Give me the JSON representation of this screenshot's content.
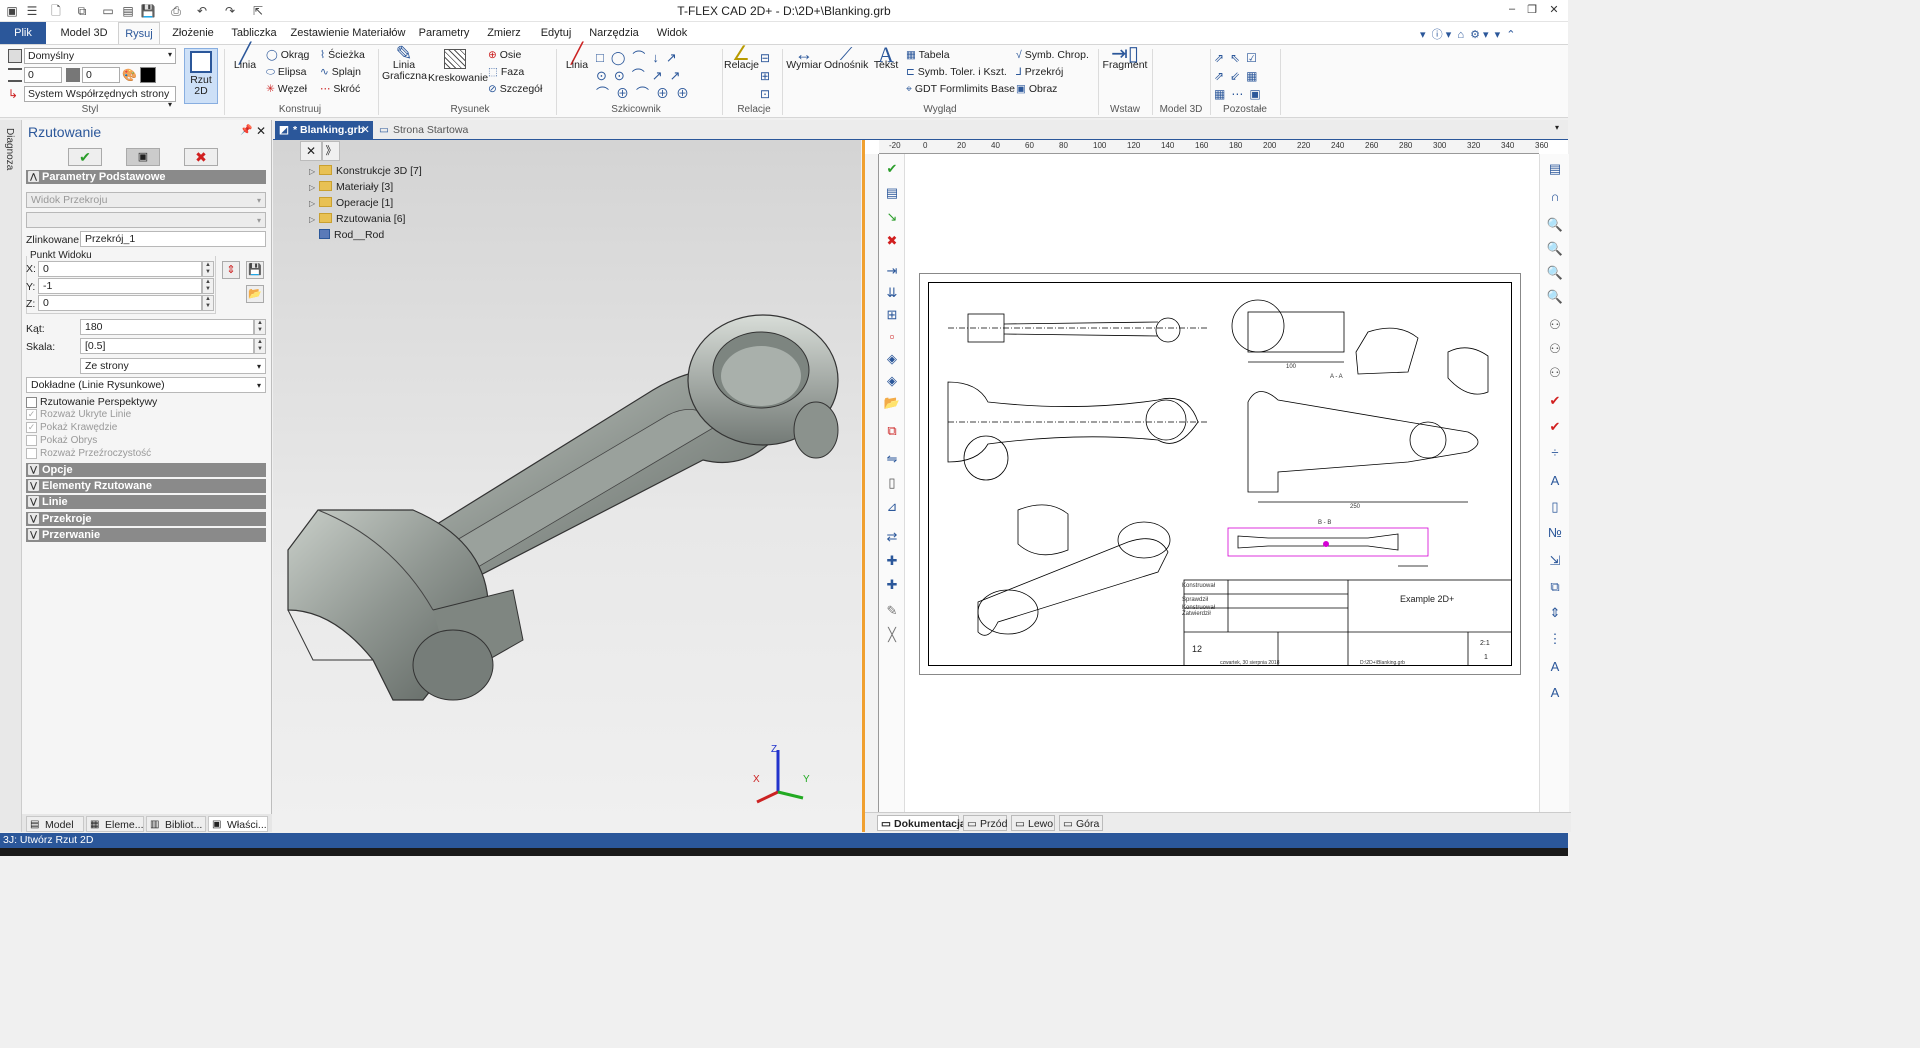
{
  "window": {
    "title": "T-FLEX CAD 2D+ - D:\\2D+\\Blanking.grb",
    "controls": [
      "–",
      "❐",
      "✕"
    ]
  },
  "menu_tabs": [
    {
      "label": "Plik"
    },
    {
      "label": "Model 3D"
    },
    {
      "label": "Rysuj"
    },
    {
      "label": "Złożenie"
    },
    {
      "label": "Tabliczka"
    },
    {
      "label": "Zestawienie Materiałów"
    },
    {
      "label": "Parametry"
    },
    {
      "label": "Zmierz"
    },
    {
      "label": "Edytuj"
    },
    {
      "label": "Narzędzia"
    },
    {
      "label": "Widok"
    }
  ],
  "ribbon": {
    "styl": {
      "style_value": "Domyślny",
      "num1": "0",
      "num2": "0",
      "coord_system": "System Współrzędnych strony",
      "rzut2d_label": "Rzut\n2D",
      "group_label": "Styl"
    },
    "konstruuj": {
      "linia": "Linia",
      "okrag": "Okrąg",
      "elipsa": "Elipsa",
      "wezel": "Węzeł",
      "sciezka": "Ścieżka",
      "splajn": "Splajn",
      "skroc": "Skróć",
      "group_label": "Konstruuj"
    },
    "rysunek": {
      "linia_graficzna": "Linia\nGraficzna",
      "kreskowanie": "Kreskowanie",
      "osie": "Osie",
      "faza": "Faza",
      "szczegol": "Szczegół",
      "group_label": "Rysunek"
    },
    "szkicownik": {
      "linia": "Linia",
      "group_label": "Szkicownik"
    },
    "relacje": {
      "relacje": "Relacje",
      "group_label": "Relacje"
    },
    "wyglad": {
      "wymiar": "Wymiar",
      "odnosnik": "Odnośnik",
      "tekst": "Tekst",
      "tabela": "Tabela",
      "symb_toler": "Symb. Toler. i Kszt.",
      "gdt": "GDT Formlimits Base",
      "symb_chrop": "Symb. Chrop.",
      "przekroj": "Przekrój",
      "obraz": "Obraz",
      "group_label": "Wygląd"
    },
    "wstaw": {
      "fragment": "Fragment",
      "group_label": "Wstaw"
    },
    "model3d": {
      "group_label": "Model 3D"
    },
    "pozostale": {
      "group_label": "Pozostałe"
    }
  },
  "left_strip": {
    "label": "Diagnoza"
  },
  "panel": {
    "title": "Rzutowanie",
    "sections": {
      "podstawowe": "Parametry Podstawowe",
      "opcje": "Opcje",
      "elementy": "Elementy Rzutowane",
      "linie": "Linie",
      "przekroje": "Przekroje",
      "przerwanie": "Przerwanie"
    },
    "widok_przekroju": "Widok Przekroju",
    "zlinkowane_label": "Zlinkowane:",
    "zlinkowane_value": "Przekrój_1",
    "punkt_widoku": "Punkt Widoku",
    "x_label": "X:",
    "x_value": "0",
    "y_label": "Y:",
    "y_value": "-1",
    "z_label": "Z:",
    "z_value": "0",
    "kat_label": "Kąt:",
    "kat_value": "180",
    "skala_label": "Skala:",
    "skala_value": "[0.5]",
    "ze_strony": "Ze strony",
    "dokladne": "Dokładne (Linie Rysunkowe)",
    "checks": [
      {
        "label": "Rzutowanie Perspektywy",
        "checked": false,
        "enabled": true
      },
      {
        "label": "Rozważ Ukryte Linie",
        "checked": true,
        "enabled": false
      },
      {
        "label": "Pokaż Krawędzie",
        "checked": true,
        "enabled": false
      },
      {
        "label": "Pokaż Obrys",
        "checked": false,
        "enabled": false
      },
      {
        "label": "Rozważ Przeźroczystość",
        "checked": false,
        "enabled": false
      }
    ],
    "bottom_tabs": [
      "Model ...",
      "Eleme...",
      "Bibliot...",
      "Właści..."
    ]
  },
  "doc_tabs": [
    {
      "label": "* Blanking.grb",
      "active": true
    },
    {
      "label": "Strona Startowa",
      "active": false
    }
  ],
  "tree": [
    {
      "label": "Konstrukcje 3D [7]"
    },
    {
      "label": "Materiały [3]"
    },
    {
      "label": "Operacje [1]"
    },
    {
      "label": "Rzutowania [6]"
    },
    {
      "label": "Rod__Rod"
    }
  ],
  "axes": {
    "x": "X",
    "y": "Y",
    "z": "Z"
  },
  "drawing": {
    "title_block": {
      "example": "Example 2D+",
      "sheet_no": "12",
      "scale": "2:1",
      "page": "1",
      "path": "D:\\2D+\\Blanking.grb",
      "date": "czwartek, 30 sierpnia 2018",
      "rows": [
        "Konstruował",
        "Sprawdził",
        "Zatwierdził"
      ]
    },
    "labels": {
      "aa": "A - A",
      "bb": "B - B",
      "dim250": "250",
      "dim100": "100"
    }
  },
  "ruler_numbers": [
    "-20",
    "0",
    "20",
    "40",
    "60",
    "80",
    "100",
    "120",
    "140",
    "160",
    "180",
    "200",
    "220",
    "240",
    "260",
    "280",
    "300",
    "320",
    "340",
    "360"
  ],
  "sheet_tabs": [
    "Dokumentacja",
    "Przód",
    "Lewo",
    "Góra"
  ],
  "status": "3J: Utwórz Rzut 2D",
  "colors": {
    "accent": "#2b579a",
    "ok": "#2a9d2a",
    "cancel": "#d11f1f",
    "orange": "#f0a030"
  }
}
